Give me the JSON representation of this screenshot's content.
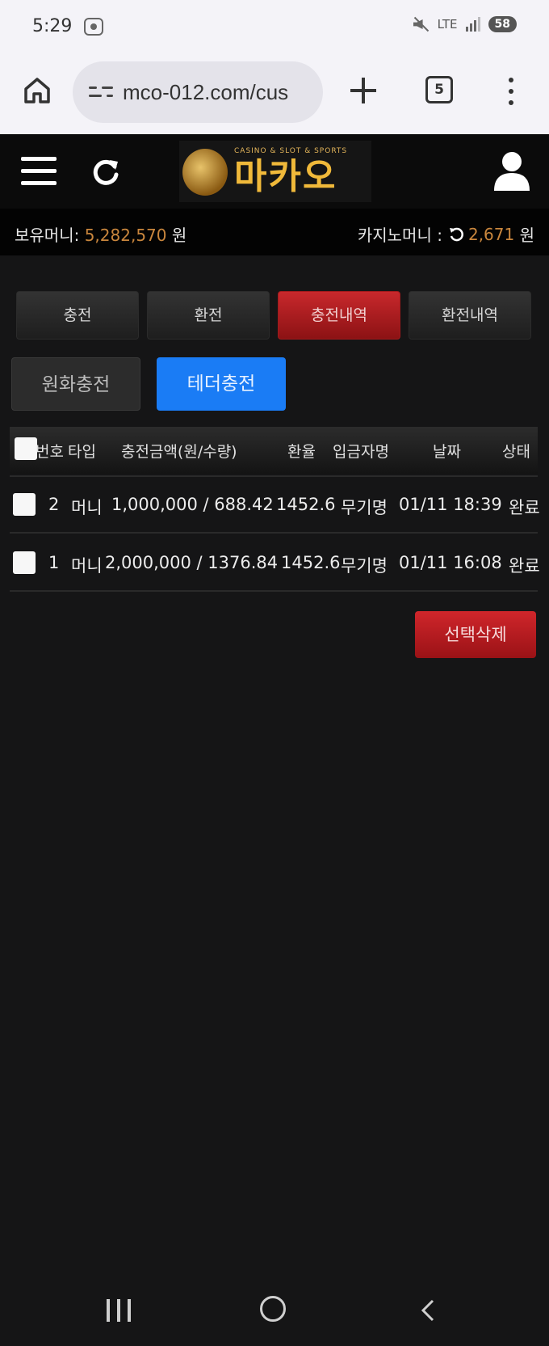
{
  "status_bar": {
    "time": "5:29",
    "network": "LTE",
    "battery": "58"
  },
  "browser": {
    "url": "mco-012.com/cus",
    "tab_count": "5"
  },
  "logo": {
    "subtitle": "CASINO & SLOT & SPORTS",
    "title": "마카오"
  },
  "money": {
    "holding_label": "보유머니:",
    "holding_value": "5,282,570",
    "holding_unit": "원",
    "casino_label": "카지노머니 :",
    "casino_value": "2,671",
    "casino_unit": "원"
  },
  "tabs": [
    {
      "label": "충전",
      "active": false
    },
    {
      "label": "환전",
      "active": false
    },
    {
      "label": "충전내역",
      "active": true
    },
    {
      "label": "환전내역",
      "active": false
    }
  ],
  "subtabs": {
    "krw": "원화충전",
    "tether": "테더충전"
  },
  "table": {
    "headers": {
      "no": "번호",
      "type": "타입",
      "amount": "충전금액(원/수량)",
      "rate": "환율",
      "depositor": "입금자명",
      "date": "날짜",
      "status": "상태"
    },
    "rows": [
      {
        "no": "2",
        "type": "머니",
        "amount": "1,000,000 / 688.42",
        "rate": "1452.6",
        "depositor": "무기명",
        "date": "01/11 18:39",
        "status": "완료"
      },
      {
        "no": "1",
        "type": "머니",
        "amount": "2,000,000 / 1376.84",
        "rate": "1452.6",
        "depositor": "무기명",
        "date": "01/11 16:08",
        "status": "완료"
      }
    ]
  },
  "actions": {
    "delete_selected": "선택삭제"
  }
}
